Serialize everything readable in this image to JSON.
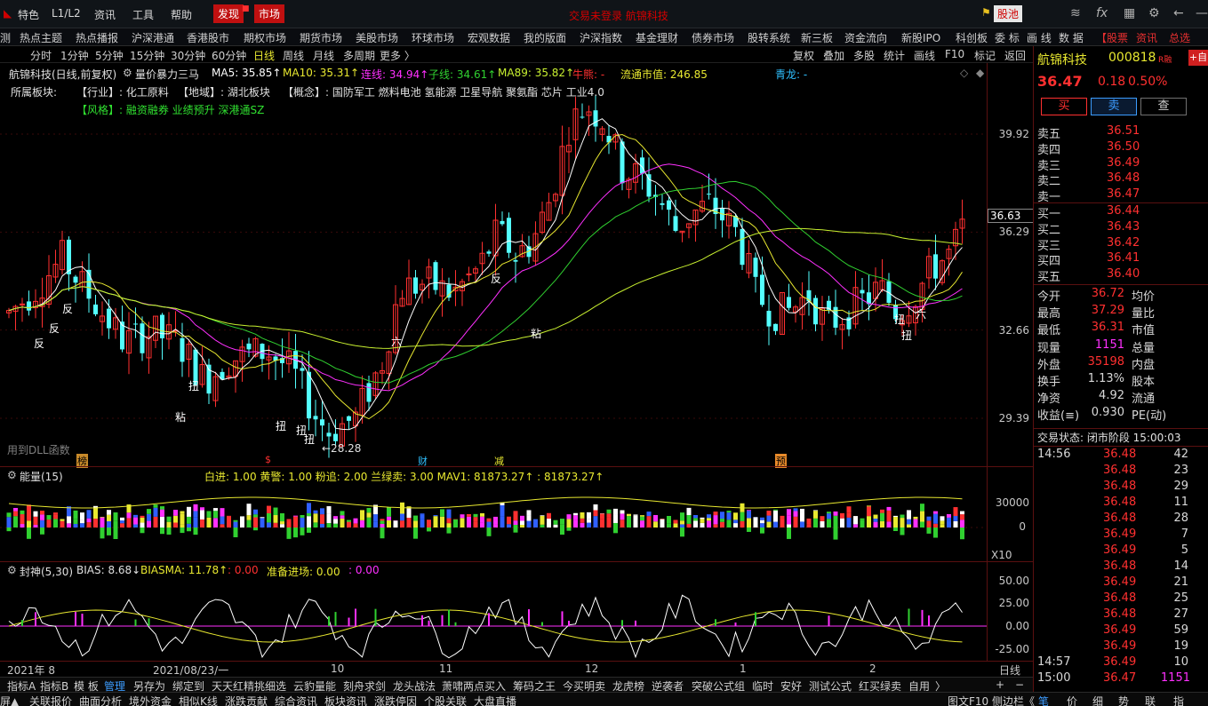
{
  "menubar": {
    "items": [
      "特色",
      "L1/L2",
      "资讯",
      "工具",
      "帮助"
    ],
    "discover": "发现",
    "market": "市场",
    "title": "交易未登录  航锦科技",
    "guchi": "股池"
  },
  "navbar": {
    "items": [
      "热点主题",
      "热点播报",
      "沪深港通",
      "香港股市",
      "期权市场",
      "期货市场",
      "美股市场",
      "环球市场",
      "宏观数据",
      "我的版面",
      "沪深指数",
      "基金理财",
      "债券市场",
      "股转系统",
      "新三板",
      "资金流向",
      "新股IPO",
      "科创板",
      "委 标",
      "画 线",
      "数 据"
    ],
    "red_items": [
      "【股票",
      "资讯",
      "总选"
    ]
  },
  "toolbar": {
    "periods": [
      "分时",
      "1分钟",
      "5分钟",
      "15分钟",
      "30分钟",
      "60分钟",
      "日线",
      "周线",
      "月线",
      "多周期",
      "更多 〉"
    ],
    "active_period": "日线",
    "right_tools": [
      "复权",
      "叠加",
      "多股",
      "统计",
      "画线",
      "F10",
      "标记",
      "返回"
    ]
  },
  "chart_header": {
    "stock_name": "航锦科技(日线,前复权)",
    "indicator": "量价暴力三马",
    "ma5": "MA5: 35.85↑",
    "ma10": "MA10: 35.31↑",
    "lian": "连线: 34.94↑",
    "zi": "子线: 34.61↑",
    "ma89": "MA89: 35.82↑",
    "niu": "牛熊: -",
    "mktcap": "流通市值: 246.85",
    "qinglong": "青龙: -",
    "sector_label": "所属板块:",
    "industry": "【行业】: 化工原料",
    "region": "【地域】: 湖北板块",
    "concept": "【概念】: 国防军工 燃料电池 氢能源 卫星导航 聚氨酯 芯片 工业4.0",
    "style": "【风格】: 融资融券 业绩预升 深港通SZ",
    "dll_note": "用到DLL函数",
    "low_note": "←28.28",
    "y_labels": [
      "39.92",
      "36.29",
      "32.66",
      "29.39"
    ],
    "current_price_tag": "36.63",
    "markers": [
      "反",
      "反",
      "反",
      "粘",
      "扭",
      "扭",
      "扭",
      "扭",
      "六",
      "反",
      "粘",
      "扭",
      "六",
      "扭"
    ],
    "event_tags": [
      "榜",
      "$",
      "财",
      "减",
      "预"
    ]
  },
  "volume_panel": {
    "title": "能量(15)",
    "legend": "白进: 1.00  黄警: 1.00  粉追: 2.00  兰绿卖: 3.00  MAV1: 81873.27↑  : 81873.27↑",
    "y_labels": [
      "30000",
      "0"
    ],
    "scale": "X10"
  },
  "bias_panel": {
    "title": "封神(5,30)",
    "bias": "BIAS: 8.68↓",
    "biasma": "BIASMA: 11.78↑",
    "extra1": ": 0.00",
    "prep": "准备进场: 0.00",
    "extra2": ": 0.00",
    "y_labels": [
      "50.00",
      "25.00",
      "0.00",
      "-25.00"
    ]
  },
  "date_axis": {
    "labels": [
      "2021年 8",
      "2021/08/23/一",
      "10",
      "11",
      "12",
      "1",
      "2"
    ],
    "period": "日线"
  },
  "bottom_tabs": [
    "指标A",
    "指标B",
    "模 板",
    "管理",
    "另存为",
    "绑定到",
    "天天红精挑细选",
    "云豹量能",
    "刻舟求剑",
    "龙头战法",
    "萧啸两点买入",
    "筹码之王",
    "今买明卖",
    "龙虎榜",
    "逆袭者",
    "突破公式组",
    "临时",
    "安好",
    "测试公式",
    "红买绿卖",
    "自用"
  ],
  "status_bar": {
    "items": [
      "关联报价",
      "曲面分析",
      "境外资金",
      "相似K线",
      "涨跌贡献",
      "综合资讯",
      "板块资讯",
      "涨跌停因",
      "个股关联",
      "大盘直播"
    ],
    "left": "屏▲",
    "right_items": [
      "图文F10",
      "侧边栏《",
      "笔",
      "价",
      "细",
      "势",
      "联",
      "指"
    ]
  },
  "quote": {
    "name": "航锦科技",
    "code": "000818",
    "tag": "R融",
    "price": "36.47",
    "change": "0.18",
    "pct": "0.50%",
    "buttons": [
      "买",
      "卖",
      "查"
    ],
    "asks": [
      {
        "label": "卖五",
        "price": "36.51"
      },
      {
        "label": "卖四",
        "price": "36.50"
      },
      {
        "label": "卖三",
        "price": "36.49"
      },
      {
        "label": "卖二",
        "price": "36.48"
      },
      {
        "label": "卖一",
        "price": "36.47"
      }
    ],
    "bids": [
      {
        "label": "买一",
        "price": "36.44"
      },
      {
        "label": "买二",
        "price": "36.43"
      },
      {
        "label": "买三",
        "price": "36.42"
      },
      {
        "label": "买四",
        "price": "36.41"
      },
      {
        "label": "买五",
        "price": "36.40"
      }
    ],
    "stats": [
      {
        "l1": "今开",
        "v1": "36.72",
        "l2": "均价"
      },
      {
        "l1": "最高",
        "v1": "37.29",
        "l2": "量比"
      },
      {
        "l1": "最低",
        "v1": "36.31",
        "l2": "市值"
      },
      {
        "l1": "现量",
        "v1": "1151",
        "l2": "总量"
      },
      {
        "l1": "外盘",
        "v1": "35198",
        "l2": "内盘"
      },
      {
        "l1": "换手",
        "v1": "1.13%",
        "l2": "股本"
      },
      {
        "l1": "净资",
        "v1": "4.92",
        "l2": "流通"
      },
      {
        "l1": "收益(≡)",
        "v1": "0.930",
        "l2": "PE(动)"
      }
    ],
    "trade_status": "交易状态: 闭市阶段 15:00:03",
    "ticks": [
      {
        "t": "14:56",
        "p": "36.48",
        "v": "42"
      },
      {
        "t": "",
        "p": "36.48",
        "v": "23"
      },
      {
        "t": "",
        "p": "36.48",
        "v": "29"
      },
      {
        "t": "",
        "p": "36.48",
        "v": "11"
      },
      {
        "t": "",
        "p": "36.48",
        "v": "28"
      },
      {
        "t": "",
        "p": "36.49",
        "v": "7"
      },
      {
        "t": "",
        "p": "36.49",
        "v": "5"
      },
      {
        "t": "",
        "p": "36.48",
        "v": "14"
      },
      {
        "t": "",
        "p": "36.49",
        "v": "21"
      },
      {
        "t": "",
        "p": "36.48",
        "v": "25"
      },
      {
        "t": "",
        "p": "36.48",
        "v": "27"
      },
      {
        "t": "",
        "p": "36.49",
        "v": "59"
      },
      {
        "t": "",
        "p": "36.49",
        "v": "19"
      },
      {
        "t": "14:57",
        "p": "36.49",
        "v": "10"
      },
      {
        "t": "15:00",
        "p": "36.47",
        "v": "1151"
      }
    ]
  },
  "colors": {
    "up": "#ff3030",
    "down": "#54ffff",
    "ma5": "#ffffff",
    "ma10": "#e8e830",
    "lian": "#ff30ff",
    "zi": "#30d030",
    "ma89": "#c8f030"
  },
  "chart_data": {
    "type": "candlestick",
    "y_axis_ticks": [
      29.39,
      32.66,
      36.29,
      39.92
    ],
    "current_price": 36.63,
    "period_low": 28.28,
    "last_close": 36.47,
    "series": [
      {
        "name": "MA5",
        "value": 35.85
      },
      {
        "name": "MA10",
        "value": 35.31
      },
      {
        "name": "连线",
        "value": 34.94
      },
      {
        "name": "子线",
        "value": 34.61
      },
      {
        "name": "MA89",
        "value": 35.82
      }
    ]
  }
}
